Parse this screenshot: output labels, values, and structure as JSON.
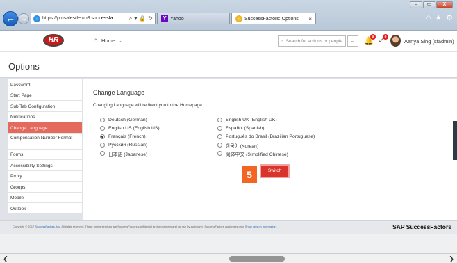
{
  "browser": {
    "window_controls": {
      "minimize": "–",
      "maximize": "▭",
      "close": "X"
    },
    "address_prefix": "https://pmsalesdemo8.",
    "address_host": "successfa...",
    "tabs": [
      {
        "label": "Yahoo"
      },
      {
        "label": "SuccessFactors: Options",
        "close": "×"
      }
    ]
  },
  "header": {
    "logo_text": "HR",
    "home_label": "Home",
    "search_placeholder": "Search for actions or people",
    "notification_badges": [
      "9",
      "8"
    ],
    "user_name": "Aanya Sing (sfadmin)"
  },
  "page": {
    "title": "Options"
  },
  "sidebar": {
    "items": [
      {
        "label": "Password"
      },
      {
        "label": "Start Page"
      },
      {
        "label": "Sub Tab Configuration"
      },
      {
        "label": "Notifications"
      },
      {
        "label": "Change Language"
      },
      {
        "label": "Compensation Number Format"
      },
      {
        "label": "Forms"
      },
      {
        "label": "Accessibility Settings"
      },
      {
        "label": "Proxy"
      },
      {
        "label": "Groups"
      },
      {
        "label": "Mobile"
      },
      {
        "label": "Outlook"
      }
    ],
    "active_index": 4
  },
  "main": {
    "title": "Change Language",
    "description": "Changing Language will redirect you to the Homepage.",
    "languages_col1": [
      {
        "label": "Deutsch (German)",
        "checked": false
      },
      {
        "label": "English US (English US)",
        "checked": false
      },
      {
        "label": "Français (French)",
        "checked": true
      },
      {
        "label": "Pусский (Russian)",
        "checked": false
      },
      {
        "label": "日本語 (Japanese)",
        "checked": false
      }
    ],
    "languages_col2": [
      {
        "label": "English UK (English UK)",
        "checked": false
      },
      {
        "label": "Español (Spanish)",
        "checked": false
      },
      {
        "label": "Português do Brasil (Brazilian Portuguese)",
        "checked": false
      },
      {
        "label": "한국어 (Korean)",
        "checked": false
      },
      {
        "label": "简体中文 (Simplified Chinese)",
        "checked": false
      }
    ],
    "step_number": "5",
    "switch_label": "Switch"
  },
  "footer": {
    "copyright_prefix": "Copyright © 2017 ",
    "copyright_link": "SuccessFactors, Inc.",
    "copyright_text": " All rights reserved. These online services are SuccessFactors confidential and proprietary and for use by authorized SuccessFactors customers only. ",
    "version_link": "Show version information.",
    "brand": "SAP SuccessFactors"
  },
  "colors": {
    "active_nav": "#e46a5e",
    "switch_button": "#d9342b",
    "step_badge": "#f26522"
  }
}
